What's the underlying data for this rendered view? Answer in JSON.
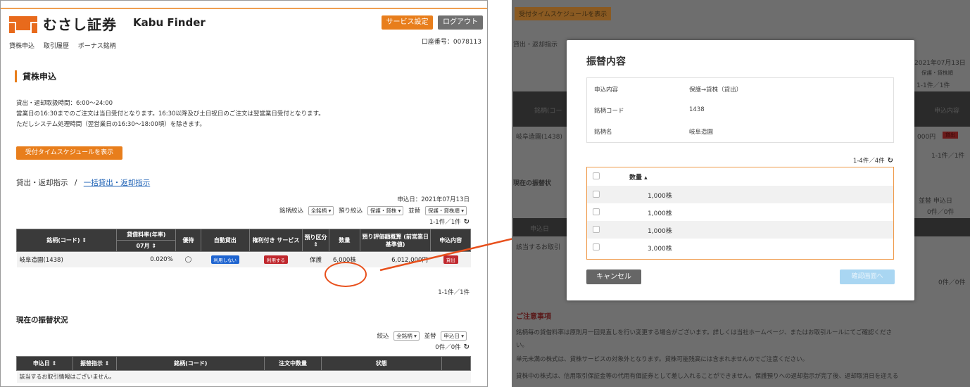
{
  "left": {
    "brand": "むさし証券",
    "app_name": "Kabu Finder",
    "service_settings": "サービス設定",
    "logout": "ログアウト",
    "nav": [
      "貸株申込",
      "取引履歴",
      "ボーナス銘柄"
    ],
    "account": "口座番号：0078113",
    "section_title": "貸株申込",
    "info": [
      "貸出・返却取扱時間：6:00〜24:00",
      "営業日の16:30までのご注文は当日受付となります。16:30以降及び土日祝日のご注文は翌営業日受付となります。",
      "ただしシステム処理時間（翌営業日の16:30〜18:00頃）を除きます。"
    ],
    "schedule_button": "受付タイムスケジュールを表示",
    "subhead": "貸出・返却指示",
    "subhead_sep": "/",
    "subhead_link": "一括貸出・返却指示",
    "apply_date": "申込日：2021年07月13日",
    "filter": {
      "label1": "銘柄絞込",
      "sel1": "全銘柄",
      "label2": "預り絞込",
      "sel2": "保護・貸株",
      "label3": "並替",
      "sel3": "保護・貸株順"
    },
    "count_top": "1-1件／1件",
    "count_bottom": "1-1件／1件",
    "table1": {
      "headers": [
        "銘柄(コード)",
        "貸借料率(年率)",
        "07月",
        "優待",
        "自動貸出",
        "権利付き サービス",
        "預り区分",
        "数量",
        "預り評価額概算 (前営業日基準値)",
        "申込内容"
      ],
      "row": {
        "name": "岐阜造園(1438)",
        "rate": "0.020%",
        "yutai": "◯",
        "auto": "利用しない",
        "rights": "利用する",
        "kubun": "保護",
        "qty": "6,000株",
        "value": "6,012,000円",
        "apply": "貸出"
      }
    },
    "h2": "現在の振替状況",
    "filter2": {
      "label1": "絞込",
      "sel1": "全銘柄",
      "label2": "並替",
      "sel2": "申込日"
    },
    "count2": "0件／0件",
    "table2": {
      "headers": [
        "申込日",
        "振替指示",
        "銘柄(コード)",
        "注文中数量",
        "状態",
        ""
      ],
      "empty": "該当するお取引情報はございません。"
    }
  },
  "right": {
    "bg": {
      "schedule_button": "受付タイムスケジュールを表示",
      "subhead": "貸出・返却指示",
      "date": "2021年07月13日",
      "filter": "保護・貸株順",
      "count": "1-1件／1件",
      "col_name": "銘柄(コー",
      "col_apply": "申込内容",
      "row_name": "岐阜造園(1438)",
      "row_value": "000円",
      "apply": "貸出",
      "count_b": "1-1件／1件",
      "section2": "現在の振替状",
      "sort": "並替",
      "sort_sel": "申込日",
      "count2": "0件／0件",
      "col2": "申込日",
      "empty": "該当するお取引",
      "count3": "0件／0件",
      "notice_title": "ご注意事項",
      "notice": [
        "銘柄毎の貸借料率は原則月一回見直しを行い変更する場合がございます。詳しくは当社ホームページ、またはお取引ルールにてご確認くださ",
        "い。",
        "単元未満の株式は、貸株サービスの対象外となります。貸株可能残高には含まれませんのでご注意ください。",
        "貸株中の株式は、信用取引保証金等の代用有価証券として差し入れることができません。保護預りへの返却指示が完了後、返却取消日を迎える"
      ]
    },
    "modal": {
      "title": "振替内容",
      "details": [
        {
          "k": "申込内容",
          "v": "保護→貸株（貸出）"
        },
        {
          "k": "銘柄コード",
          "v": "1438"
        },
        {
          "k": "銘柄名",
          "v": "岐阜造園"
        }
      ],
      "count": "1-4件／4件",
      "qty_header": "数量",
      "quantities": [
        "1,000株",
        "1,000株",
        "1,000株",
        "3,000株"
      ],
      "cancel": "キャンセル",
      "confirm": "確認画面へ"
    }
  },
  "colors": {
    "accent": "#e87e1c",
    "red": "#c0282e",
    "blue": "#1e64d0",
    "annotation": "#e8501c"
  }
}
